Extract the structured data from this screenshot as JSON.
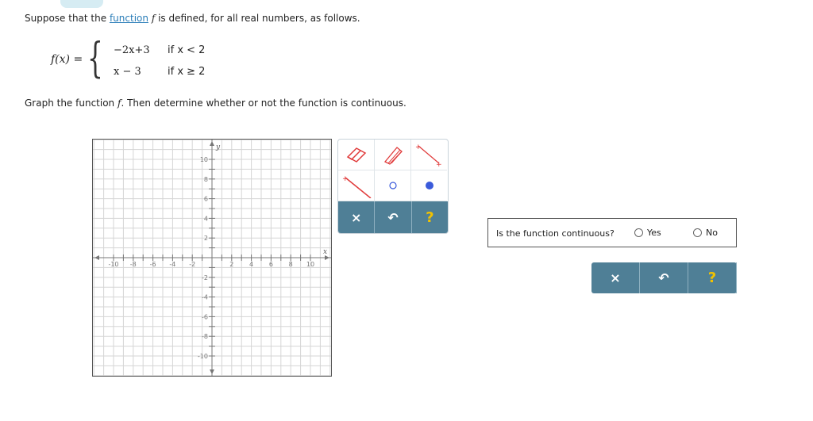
{
  "question": {
    "prefix": "Suppose that the",
    "link": "function",
    "var": "f",
    "suffix": "is defined, for all real numbers, as follows."
  },
  "piecewise": {
    "lhs": "f(x) =",
    "cases": [
      {
        "expr": "−2x+3",
        "cond": "if x < 2"
      },
      {
        "expr": "x − 3",
        "cond": "if x ≥ 2"
      }
    ]
  },
  "instruction": {
    "prefix": "Graph the function",
    "var": "f",
    "suffix": ". Then determine whether or not the function is continuous."
  },
  "graph": {
    "x_label": "x",
    "y_label": "y",
    "x_ticks": [
      "-10",
      "-8",
      "-6",
      "-4",
      "-2",
      "2",
      "4",
      "6",
      "8",
      "10"
    ],
    "y_ticks": [
      "10",
      "8",
      "6",
      "4",
      "2",
      "-2",
      "-4",
      "-6",
      "-8",
      "-10"
    ]
  },
  "tools": {
    "eraser": "eraser-icon",
    "pencil": "pencil-icon",
    "segment": "segment-icon",
    "ray": "ray-icon",
    "open_point": "open-point-icon",
    "closed_point": "closed-point-icon",
    "clear": "×",
    "undo": "↶",
    "help": "?"
  },
  "continuity": {
    "question": "Is the function continuous?",
    "yes": "Yes",
    "no": "No"
  },
  "answer_bar": {
    "clear": "×",
    "undo": "↶",
    "help": "?"
  },
  "colors": {
    "accent_bar": "#4f7f96",
    "link": "#2a7db8",
    "tool_red": "#e03a3a",
    "tool_blue": "#3b5bdb",
    "help": "#f2c200"
  }
}
